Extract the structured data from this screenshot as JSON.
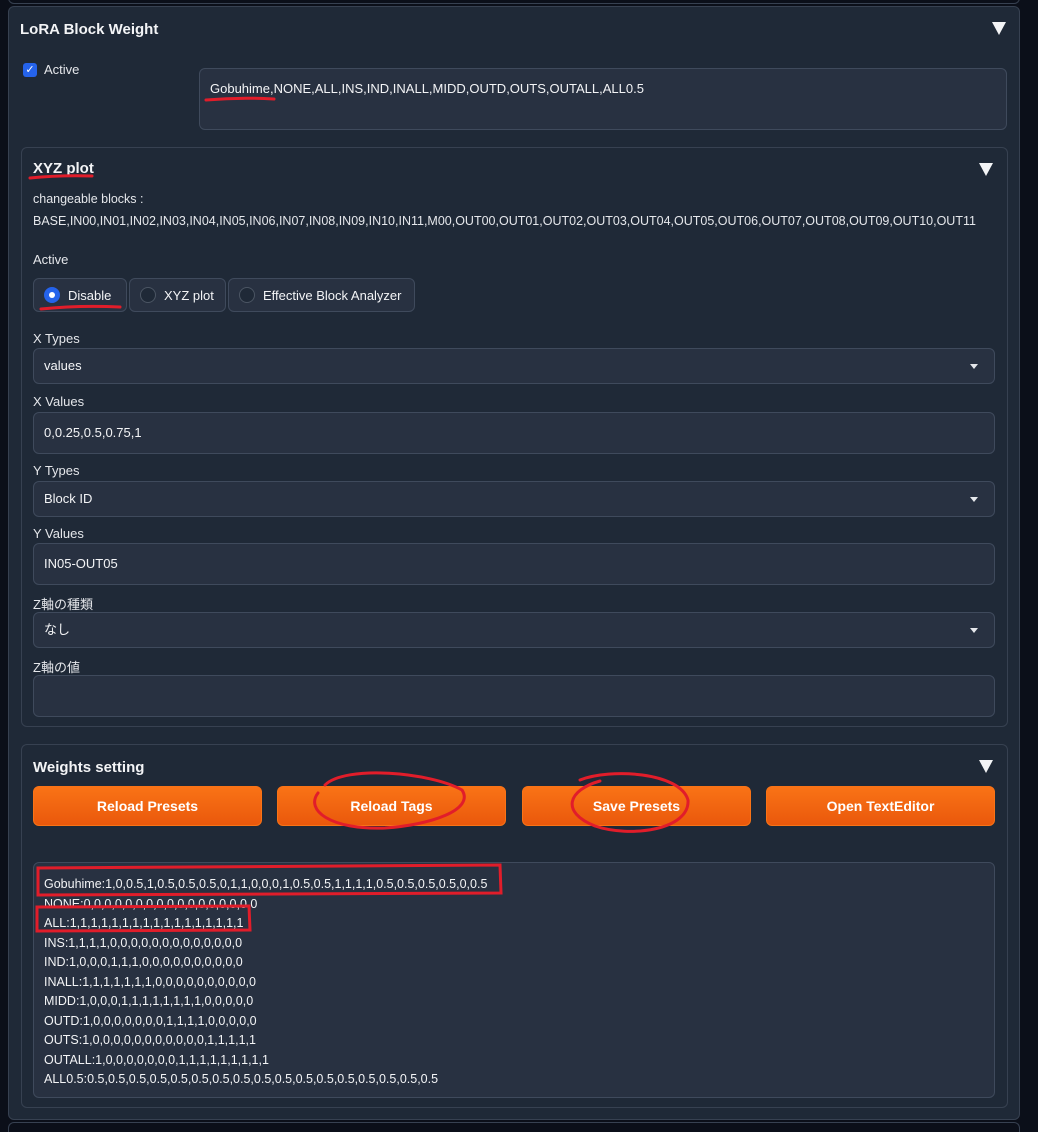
{
  "lora": {
    "title": "LoRA Block Weight",
    "active_label": "Active",
    "active_checked": true,
    "preset_text": "Gobuhime,NONE,ALL,INS,IND,INALL,MIDD,OUTD,OUTS,OUTALL,ALL0.5"
  },
  "xyz": {
    "title": "XYZ plot",
    "changeable_label": "changeable blocks :",
    "blocks": "BASE,IN00,IN01,IN02,IN03,IN04,IN05,IN06,IN07,IN08,IN09,IN10,IN11,M00,OUT00,OUT01,OUT02,OUT03,OUT04,OUT05,OUT06,OUT07,OUT08,OUT09,OUT10,OUT11",
    "active_label": "Active",
    "radios": [
      {
        "label": "Disable",
        "selected": true
      },
      {
        "label": "XYZ plot",
        "selected": false
      },
      {
        "label": "Effective Block Analyzer",
        "selected": false
      }
    ],
    "x_types_label": "X Types",
    "x_types_value": "values",
    "x_values_label": "X Values",
    "x_values_value": "0,0.25,0.5,0.75,1",
    "y_types_label": "Y Types",
    "y_types_value": "Block ID",
    "y_values_label": "Y Values",
    "y_values_value": "IN05-OUT05",
    "z_types_label": "Z軸の種類",
    "z_types_value": "なし",
    "z_values_label": "Z軸の値",
    "z_values_value": ""
  },
  "weights": {
    "title": "Weights setting",
    "buttons": [
      "Reload Presets",
      "Reload Tags",
      "Save Presets",
      "Open TextEditor"
    ],
    "lines": [
      "Gobuhime:1,0,0.5,1,0.5,0.5,0.5,0,1,1,0,0,0,1,0.5,0.5,1,1,1,1,0.5,0.5,0.5,0.5,0,0.5",
      "NONE:0,0,0,0,0,0,0,0,0,0,0,0,0,0,0,0,0",
      "ALL:1,1,1,1,1,1,1,1,1,1,1,1,1,1,1,1,1",
      "INS:1,1,1,1,0,0,0,0,0,0,0,0,0,0,0,0,0",
      "IND:1,0,0,0,1,1,1,0,0,0,0,0,0,0,0,0,0",
      "INALL:1,1,1,1,1,1,1,0,0,0,0,0,0,0,0,0,0",
      "MIDD:1,0,0,0,1,1,1,1,1,1,1,1,0,0,0,0,0",
      "OUTD:1,0,0,0,0,0,0,0,1,1,1,1,0,0,0,0,0",
      "OUTS:1,0,0,0,0,0,0,0,0,0,0,0,1,1,1,1,1",
      "OUTALL:1,0,0,0,0,0,0,0,1,1,1,1,1,1,1,1,1",
      "ALL0.5:0.5,0.5,0.5,0.5,0.5,0.5,0.5,0.5,0.5,0.5,0.5,0.5,0.5,0.5,0.5,0.5,0.5"
    ]
  },
  "colors": {
    "accent": "#2563eb",
    "button": "#f97316",
    "annotation": "#e11d2a"
  }
}
